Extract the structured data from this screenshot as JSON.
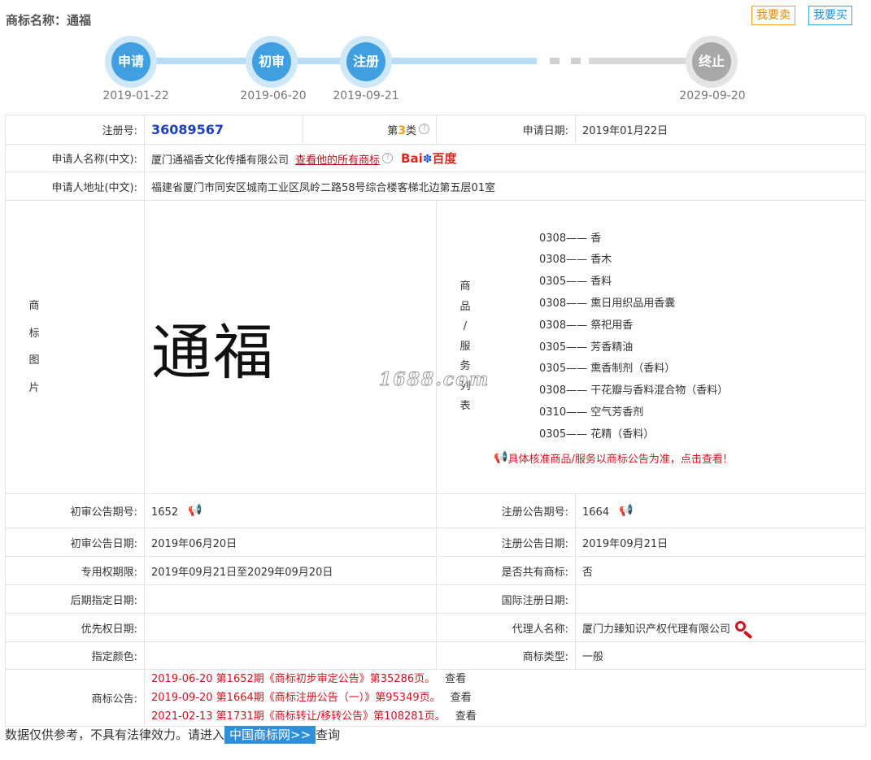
{
  "header": {
    "title": "商标名称：通福",
    "sell_label": "我要卖",
    "buy_label": "我要买"
  },
  "progress": {
    "steps": [
      {
        "label": "申请",
        "date": "2019-01-22"
      },
      {
        "label": "初审",
        "date": "2019-06-20"
      },
      {
        "label": "注册",
        "date": "2019-09-21"
      },
      {
        "label": "终止",
        "date": "2029-09-20"
      }
    ],
    "active_color": "#3f9fe0",
    "inactive_color": "#a8a8a8"
  },
  "info": {
    "reg_no_label": "注册号:",
    "reg_no": "36089567",
    "class_prefix": "第",
    "class_num": "3",
    "class_suffix": "类",
    "help_glyph": "?",
    "apply_date_label": "申请日期:",
    "apply_date": "2019年01月22日",
    "applicant_label": "申请人名称(中文):",
    "applicant": "厦门通福香文化传播有限公司",
    "all_marks_link": "查看他的所有商标",
    "baidu_text": "Bai",
    "baidu_text2": "百度",
    "address_label": "申请人地址(中文):",
    "address": "福建省厦门市同安区城南工业区凤岭二路58号综合楼客梯北边第五层01室",
    "image_label_chars": [
      "商",
      "标",
      "图",
      "片"
    ],
    "mark_text": "通福",
    "goods_label_chars": [
      "商",
      "品",
      "/",
      "服",
      "务",
      "列",
      "表"
    ],
    "goods": [
      "0308—— 香",
      "0308—— 香木",
      "0305—— 香料",
      "0308—— 熏日用织品用香囊",
      "0308—— 祭祀用香",
      "0305—— 芳香精油",
      "0305—— 熏香制剂（香料）",
      "0308—— 干花瓣与香料混合物（香料）",
      "0310—— 空气芳香剂",
      "0305—— 花精（香料）"
    ],
    "goods_notice": "具体核准商品/服务以商标公告为准，点击查看!",
    "watermark": "1688.com",
    "prelim_no_label": "初审公告期号:",
    "prelim_no": "1652",
    "reg_pub_no_label": "注册公告期号:",
    "reg_pub_no": "1664",
    "prelim_date_label": "初审公告日期:",
    "prelim_date": "2019年06月20日",
    "reg_pub_date_label": "注册公告日期:",
    "reg_pub_date": "2019年09月21日",
    "exclusive_label": "专用权期限:",
    "exclusive": "2019年09月21日至2029年09月20日",
    "shared_label": "是否共有商标:",
    "shared": "否",
    "later_label": "后期指定日期:",
    "intl_label": "国际注册日期:",
    "priority_label": "优先权日期:",
    "agent_label": "代理人名称:",
    "agent": "厦门力臻知识产权代理有限公司",
    "color_label": "指定颜色:",
    "type_label": "商标类型:",
    "type": "一般",
    "announcement_label": "商标公告:",
    "announcements": [
      "2019-06-20 第1652期《商标初步审定公告》第35286页。",
      "2019-09-20 第1664期《商标注册公告（一）》第95349页。",
      "2021-02-13 第1731期《商标转让/移转公告》第108281页。"
    ],
    "view_label": "查看"
  },
  "footer": {
    "text_before": "数据仅供参考，不具有法律效力。请进入",
    "site_link": "中国商标网>>",
    "text_after": "查询"
  }
}
